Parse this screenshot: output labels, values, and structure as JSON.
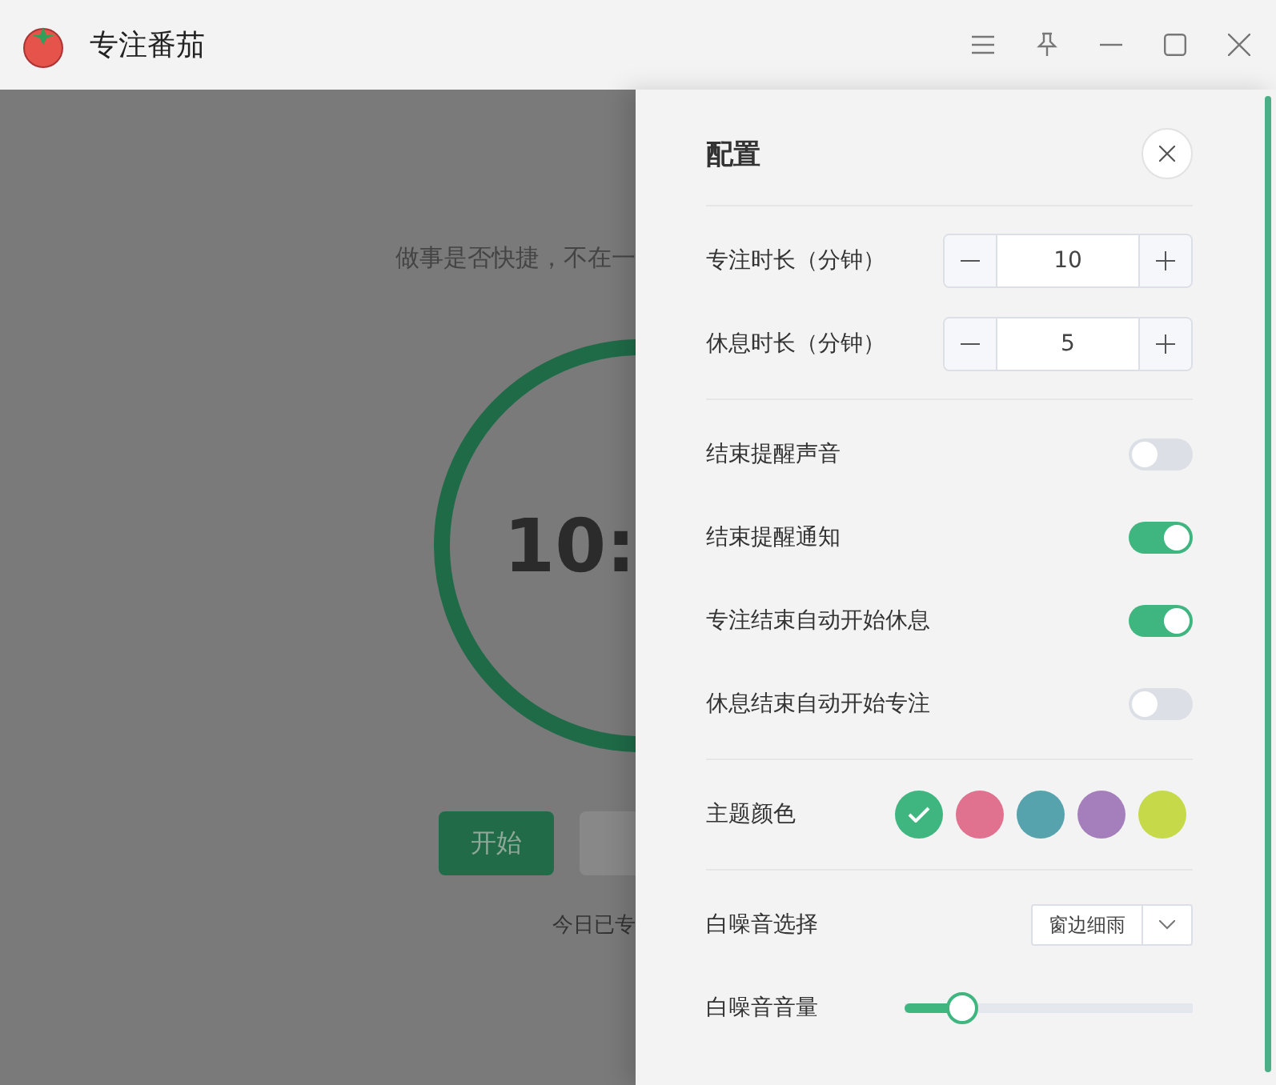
{
  "window": {
    "title": "专注番茄"
  },
  "timer_page": {
    "quote": "做事是否快捷，不在一",
    "time": "10:",
    "start_button": "开始",
    "today": "今日已专"
  },
  "settings": {
    "title": "配置",
    "steppers": [
      {
        "label": "专注时长（分钟）",
        "value": "10"
      },
      {
        "label": "休息时长（分钟）",
        "value": "5"
      }
    ],
    "toggles": [
      {
        "label": "结束提醒声音",
        "on": false
      },
      {
        "label": "结束提醒通知",
        "on": true
      },
      {
        "label": "专注结束自动开始休息",
        "on": true
      },
      {
        "label": "休息结束自动开始专注",
        "on": false
      }
    ],
    "theme": {
      "label": "主题颜色",
      "colors": [
        {
          "color": "#3fb67f",
          "selected": true
        },
        {
          "color": "#e0718f",
          "selected": false
        },
        {
          "color": "#56a3ae",
          "selected": false
        },
        {
          "color": "#a57fbb",
          "selected": false
        },
        {
          "color": "#c5d949",
          "selected": false
        }
      ]
    },
    "noise": {
      "label": "白噪音选择",
      "value": "窗边细雨"
    },
    "volume": {
      "label": "白噪音音量",
      "level": 0.2
    }
  }
}
